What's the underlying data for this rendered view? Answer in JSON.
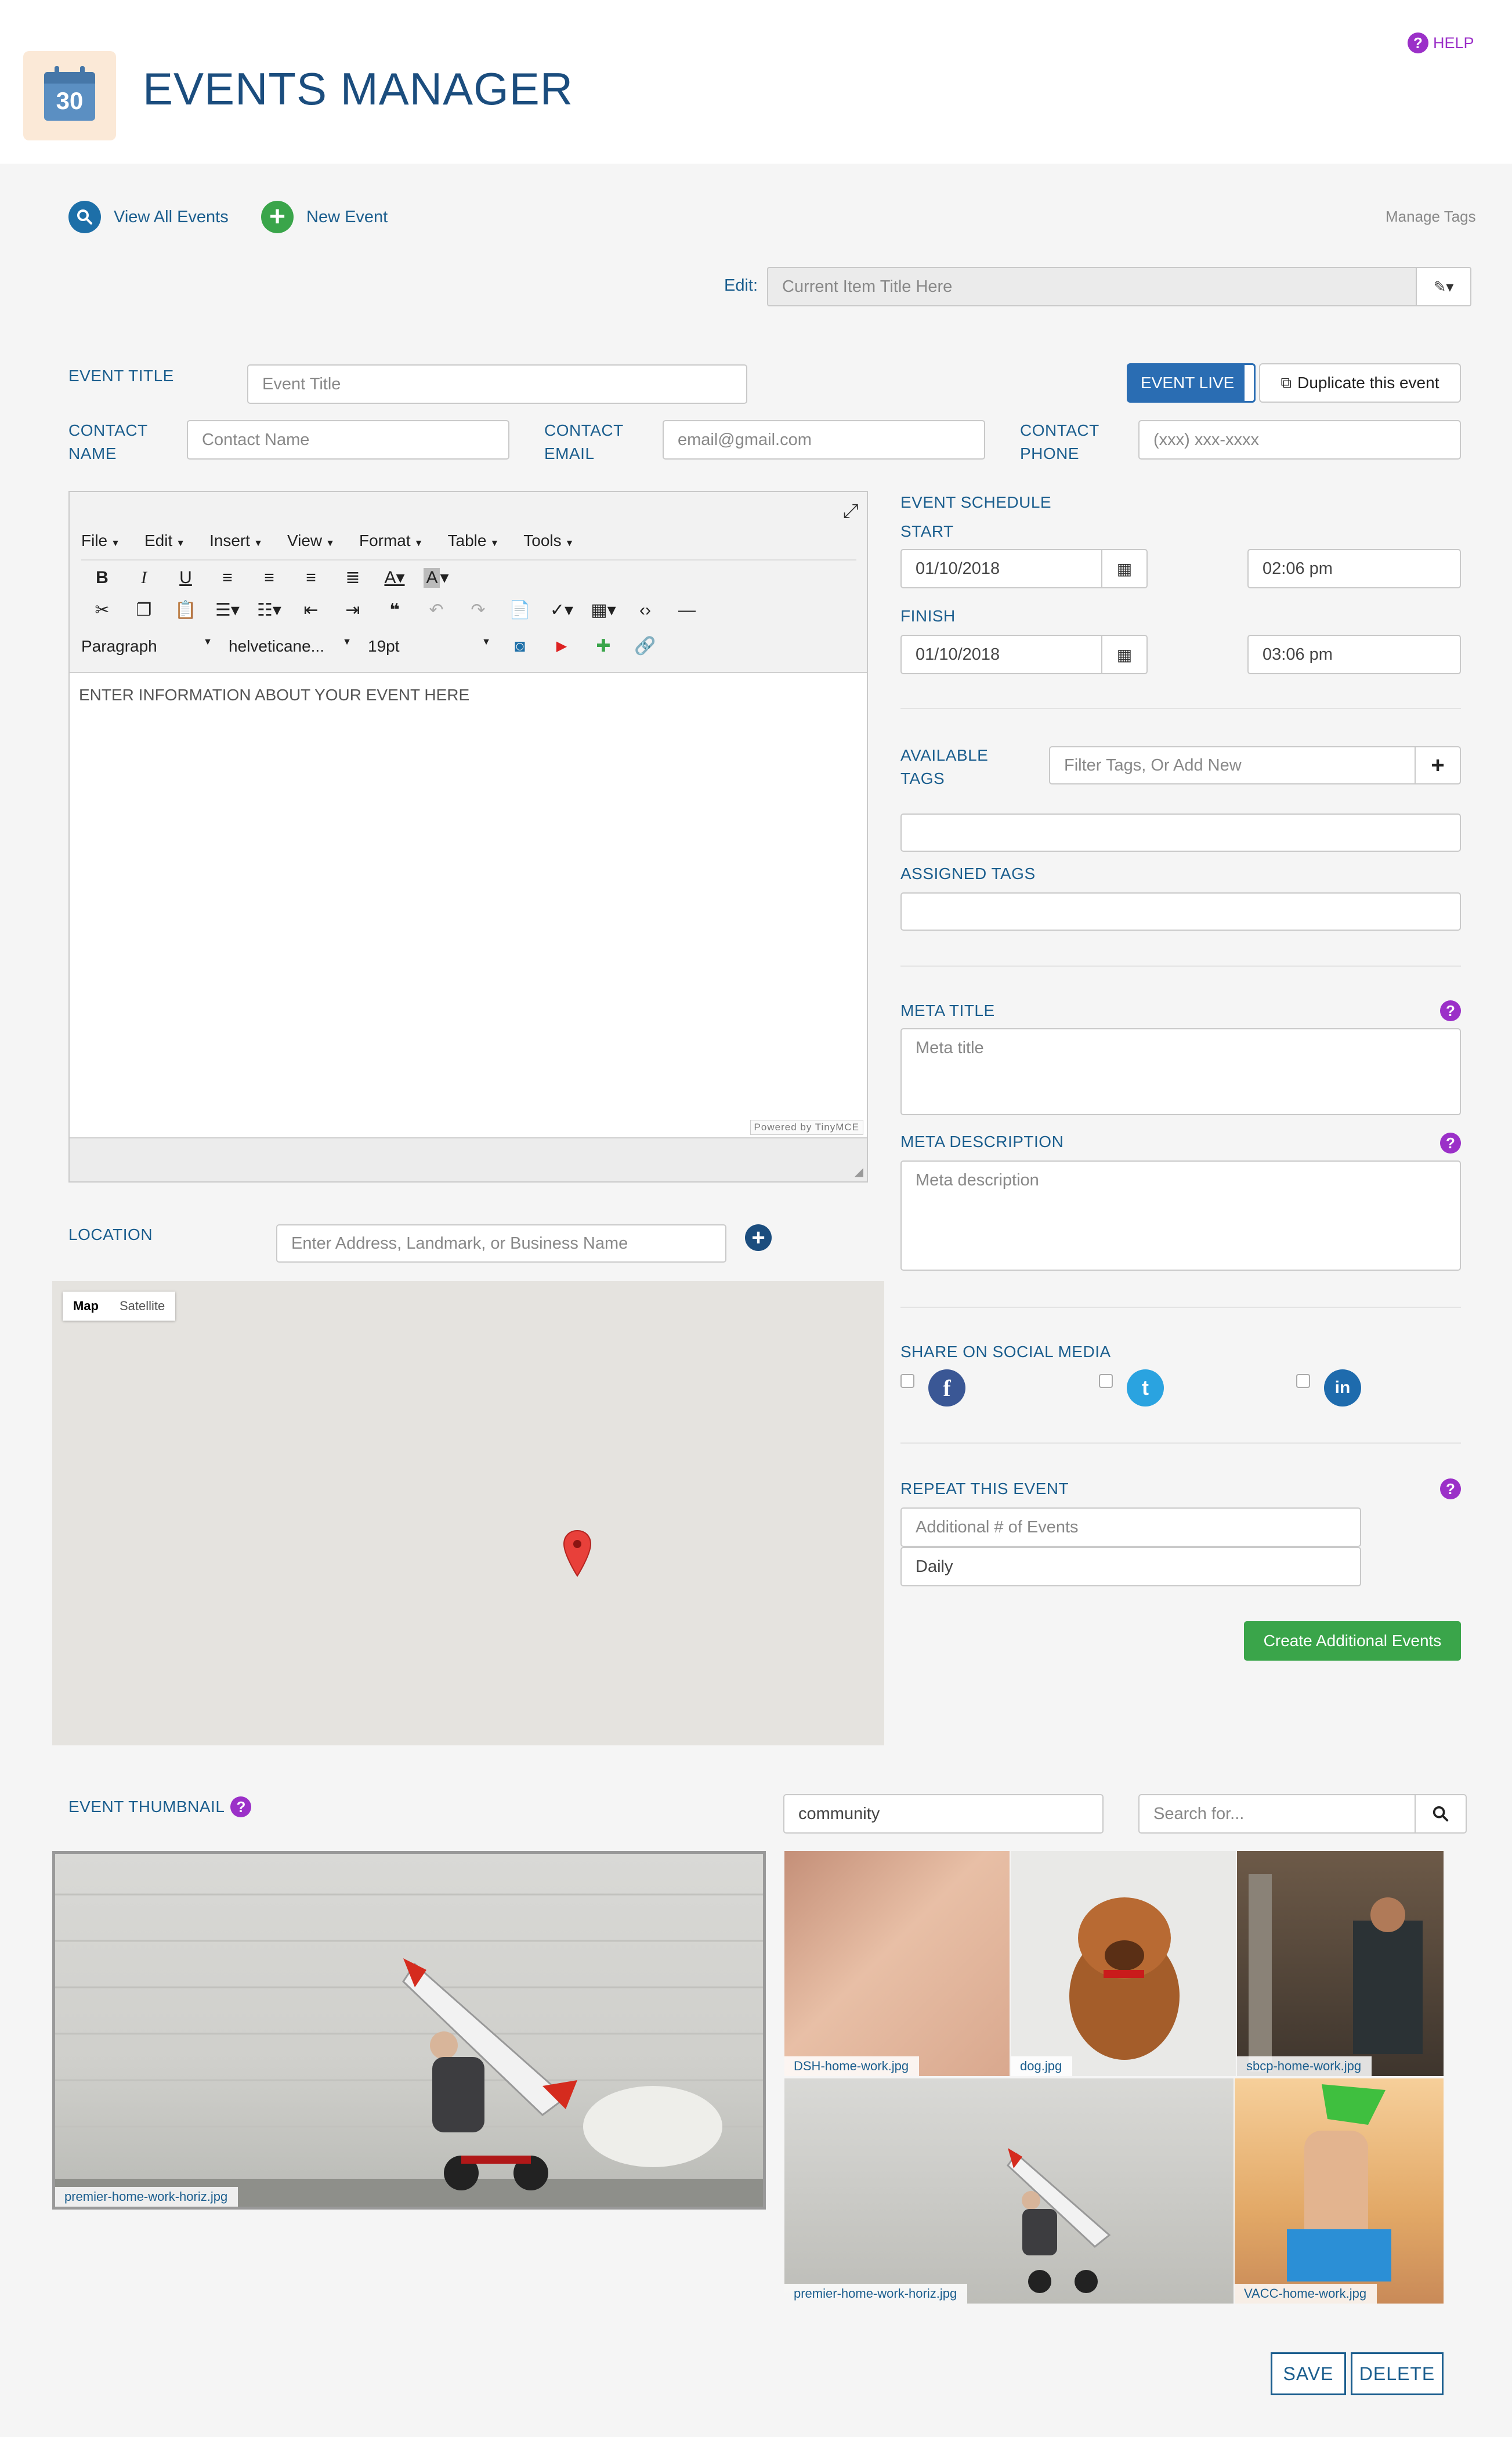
{
  "header": {
    "title": "EVENTS MANAGER",
    "calendar_day": "30",
    "help_label": "HELP"
  },
  "nav": {
    "view_all": "View All Events",
    "new_event": "New Event",
    "manage_tags": "Manage Tags"
  },
  "edit_bar": {
    "label": "Edit:",
    "placeholder": "Current Item Title Here"
  },
  "form": {
    "event_title_label": "EVENT TITLE",
    "event_title_placeholder": "Event Title",
    "event_live_label": "EVENT LIVE",
    "duplicate_label": "Duplicate this event",
    "contact_name_label_1": "CONTACT",
    "contact_name_label_2": "NAME",
    "contact_name_placeholder": "Contact Name",
    "contact_email_label_1": "CONTACT",
    "contact_email_label_2": "EMAIL",
    "contact_email_placeholder": "email@gmail.com",
    "contact_phone_label_1": "CONTACT",
    "contact_phone_label_2": "PHONE",
    "contact_phone_placeholder": "(xxx) xxx-xxxx"
  },
  "editor": {
    "menus": [
      "File",
      "Edit",
      "Insert",
      "View",
      "Format",
      "Table",
      "Tools"
    ],
    "paragraph": "Paragraph",
    "font": "helveticane...",
    "size": "19pt",
    "content": "ENTER INFORMATION ABOUT YOUR EVENT HERE",
    "powered": "Powered by TinyMCE"
  },
  "schedule": {
    "title": "EVENT SCHEDULE",
    "start_label": "START",
    "start_date": "01/10/2018",
    "start_time": "02:06 pm",
    "finish_label": "FINISH",
    "finish_date": "01/10/2018",
    "finish_time": "03:06 pm"
  },
  "tags": {
    "available_label_1": "AVAILABLE",
    "available_label_2": "TAGS",
    "filter_placeholder": "Filter Tags, Or Add New",
    "assigned_label": "ASSIGNED TAGS"
  },
  "meta": {
    "title_label": "META TITLE",
    "title_placeholder": "Meta title",
    "description_label": "META DESCRIPTION",
    "description_placeholder": "Meta description"
  },
  "social": {
    "label": "SHARE ON SOCIAL MEDIA",
    "networks": [
      "f",
      "t",
      "in"
    ]
  },
  "repeat": {
    "label": "REPEAT THIS EVENT",
    "count_placeholder": "Additional # of Events",
    "frequency": "Daily",
    "create_button": "Create Additional Events"
  },
  "location": {
    "label": "LOCATION",
    "placeholder": "Enter Address, Landmark, or Business Name",
    "map_tab": "Map",
    "satellite_tab": "Satellite"
  },
  "thumbnail": {
    "label": "EVENT THUMBNAIL",
    "selected": "premier-home-work-horiz.jpg",
    "library_filter": "community",
    "search_placeholder": "Search for...",
    "library": [
      "DSH-home-work.jpg",
      "dog.jpg",
      "sbcp-home-work.jpg",
      "premier-home-work-horiz.jpg",
      "VACC-home-work.jpg"
    ]
  },
  "actions": {
    "save": "SAVE",
    "delete": "DELETE"
  },
  "colors": {
    "brand_blue": "#1b5e8e",
    "live_blue": "#2a6db3",
    "green": "#3aa54a",
    "help_purple": "#9b30c8"
  }
}
